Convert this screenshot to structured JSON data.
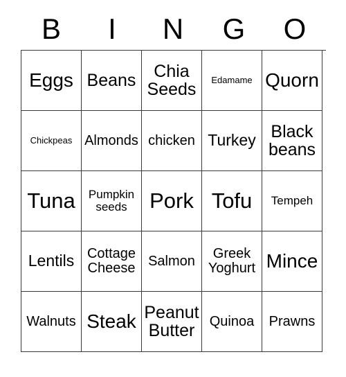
{
  "card": {
    "title": "BINGO",
    "header_letters": [
      "B",
      "I",
      "N",
      "G",
      "O"
    ],
    "columns": 5,
    "rows": 5,
    "border_color": "#3a3a3a",
    "text_color": "#000000",
    "background_color": "#ffffff",
    "cells": [
      [
        {
          "label": "Eggs",
          "size": "fs-2xl"
        },
        {
          "label": "Beans",
          "size": "fs-xl"
        },
        {
          "label": "Chia Seeds",
          "size": "fs-xl"
        },
        {
          "label": "Edamame",
          "size": "fs-xs"
        },
        {
          "label": "Quorn",
          "size": "fs-2xl"
        }
      ],
      [
        {
          "label": "Chickpeas",
          "size": "fs-xs"
        },
        {
          "label": "Almonds",
          "size": "fs-md"
        },
        {
          "label": "chicken",
          "size": "fs-md"
        },
        {
          "label": "Turkey",
          "size": "fs-lg"
        },
        {
          "label": "Black beans",
          "size": "fs-xl"
        }
      ],
      [
        {
          "label": "Tuna",
          "size": "fs-3xl"
        },
        {
          "label": "Pumpkin seeds",
          "size": "fs-sm"
        },
        {
          "label": "Pork",
          "size": "fs-3xl"
        },
        {
          "label": "Tofu",
          "size": "fs-3xl"
        },
        {
          "label": "Tempeh",
          "size": "fs-sm"
        }
      ],
      [
        {
          "label": "Lentils",
          "size": "fs-lg"
        },
        {
          "label": "Cottage Cheese",
          "size": "fs-md"
        },
        {
          "label": "Salmon",
          "size": "fs-md"
        },
        {
          "label": "Greek Yoghurt",
          "size": "fs-md"
        },
        {
          "label": "Mince",
          "size": "fs-2xl"
        }
      ],
      [
        {
          "label": "Walnuts",
          "size": "fs-md"
        },
        {
          "label": "Steak",
          "size": "fs-2xl"
        },
        {
          "label": "Peanut Butter",
          "size": "fs-xl"
        },
        {
          "label": "Quinoa",
          "size": "fs-md"
        },
        {
          "label": "Prawns",
          "size": "fs-md"
        }
      ]
    ]
  }
}
